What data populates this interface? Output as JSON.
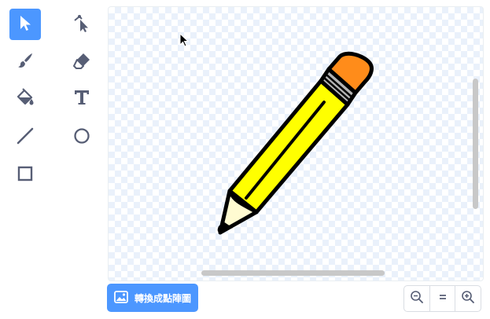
{
  "tools": [
    {
      "id": "select",
      "icon": "select-arrow-icon",
      "selected": true
    },
    {
      "id": "reshape",
      "icon": "reshape-icon",
      "selected": false
    },
    {
      "id": "brush",
      "icon": "brush-icon",
      "selected": false
    },
    {
      "id": "eraser",
      "icon": "eraser-icon",
      "selected": false
    },
    {
      "id": "fill",
      "icon": "fill-bucket-icon",
      "selected": false
    },
    {
      "id": "text",
      "icon": "text-icon",
      "selected": false
    },
    {
      "id": "line",
      "icon": "line-icon",
      "selected": false
    },
    {
      "id": "circle",
      "icon": "circle-icon",
      "selected": false
    },
    {
      "id": "rectangle",
      "icon": "rectangle-icon",
      "selected": false
    }
  ],
  "colors": {
    "accent": "#4c97ff",
    "icon": "#575e75",
    "pencil_body": "#ffff00",
    "pencil_eraser": "#ff8c1a",
    "pencil_ferrule": "#b3b3b3",
    "pencil_wood": "#fffbd1"
  },
  "convert_button": {
    "label": "轉換成點陣圖",
    "icon": "image-icon"
  },
  "zoom": {
    "zoom_out_icon": "zoom-out-icon",
    "reset_icon": "zoom-reset-icon",
    "zoom_in_icon": "zoom-in-icon"
  }
}
